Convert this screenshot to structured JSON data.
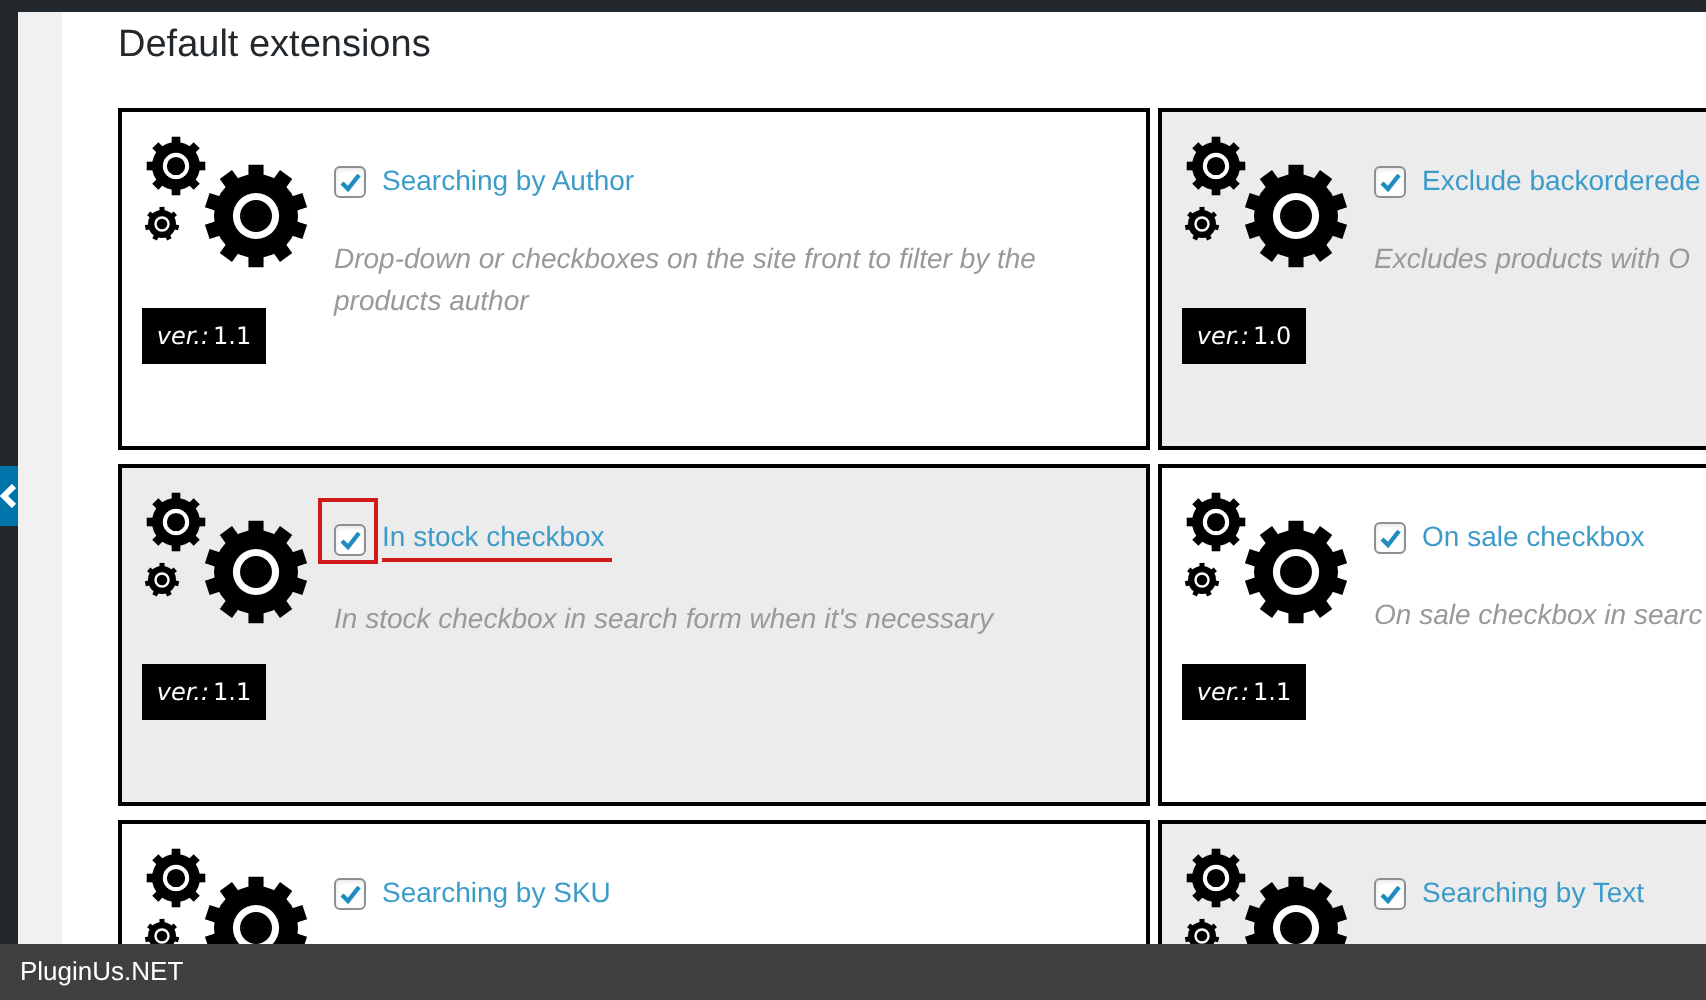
{
  "heading": "Default extensions",
  "extensions": [
    {
      "title": "Searching by Author",
      "description": "Drop-down or checkboxes on the site front to filter by the products author",
      "version_label": "ver.:",
      "version": "1.1",
      "checked": true,
      "highlighted": false,
      "annotated": false
    },
    {
      "title": "Exclude backorderede",
      "description": "Excludes products with O",
      "version_label": "ver.:",
      "version": "1.0",
      "checked": true,
      "highlighted": true,
      "annotated": false
    },
    {
      "title": "In stock checkbox",
      "description": "In stock checkbox in search form when it's necessary",
      "version_label": "ver.:",
      "version": "1.1",
      "checked": true,
      "highlighted": true,
      "annotated": true
    },
    {
      "title": "On sale checkbox",
      "description": "On sale checkbox in searc",
      "version_label": "ver.:",
      "version": "1.1",
      "checked": true,
      "highlighted": false,
      "annotated": false
    },
    {
      "title": "Searching by SKU",
      "checked": true,
      "highlighted": false,
      "annotated": false
    },
    {
      "title": "Searching by Text",
      "checked": true,
      "highlighted": true,
      "annotated": false
    }
  ],
  "caption": "PluginUs.NET"
}
